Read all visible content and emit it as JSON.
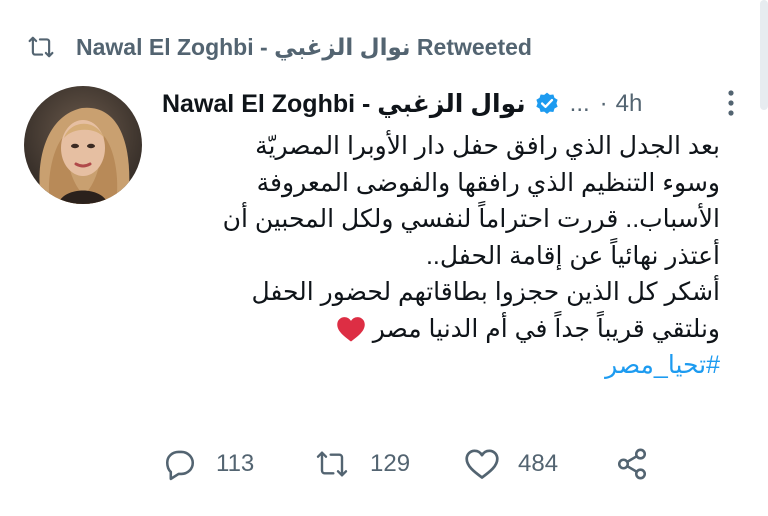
{
  "retweet": {
    "icon": "retweet-icon",
    "text": "Nawal El Zoghbi - نوال الزغبي Retweeted"
  },
  "author": {
    "avatar": "profile-photo",
    "display_name": "Nawal El Zoghbi - نوال الزغبي",
    "verified": true,
    "handle": "...",
    "separator": "·",
    "time": "4h"
  },
  "tweet": {
    "lines": [
      "بعد الجدل الذي رافق حفل دار الأوبرا المصريّة",
      "وسوء التنظيم الذي رافقها والفوضى المعروفة",
      "الأسباب.. قررت احتراماً لنفسي ولكل المحبين أن",
      "أعتذر نهائياً عن إقامة الحفل..",
      "أشكر كل الذين حجزوا بطاقاتهم لحضور الحفل",
      "ونلتقي قريباً جداً في أم الدنيا مصر"
    ],
    "hashtag": "#تحيا_مصر"
  },
  "actions": {
    "reply_count": "113",
    "retweet_count": "129",
    "like_count": "484"
  },
  "colors": {
    "accent": "#1d9bf0",
    "secondary_text": "#536471",
    "heart": "#e0245e"
  }
}
